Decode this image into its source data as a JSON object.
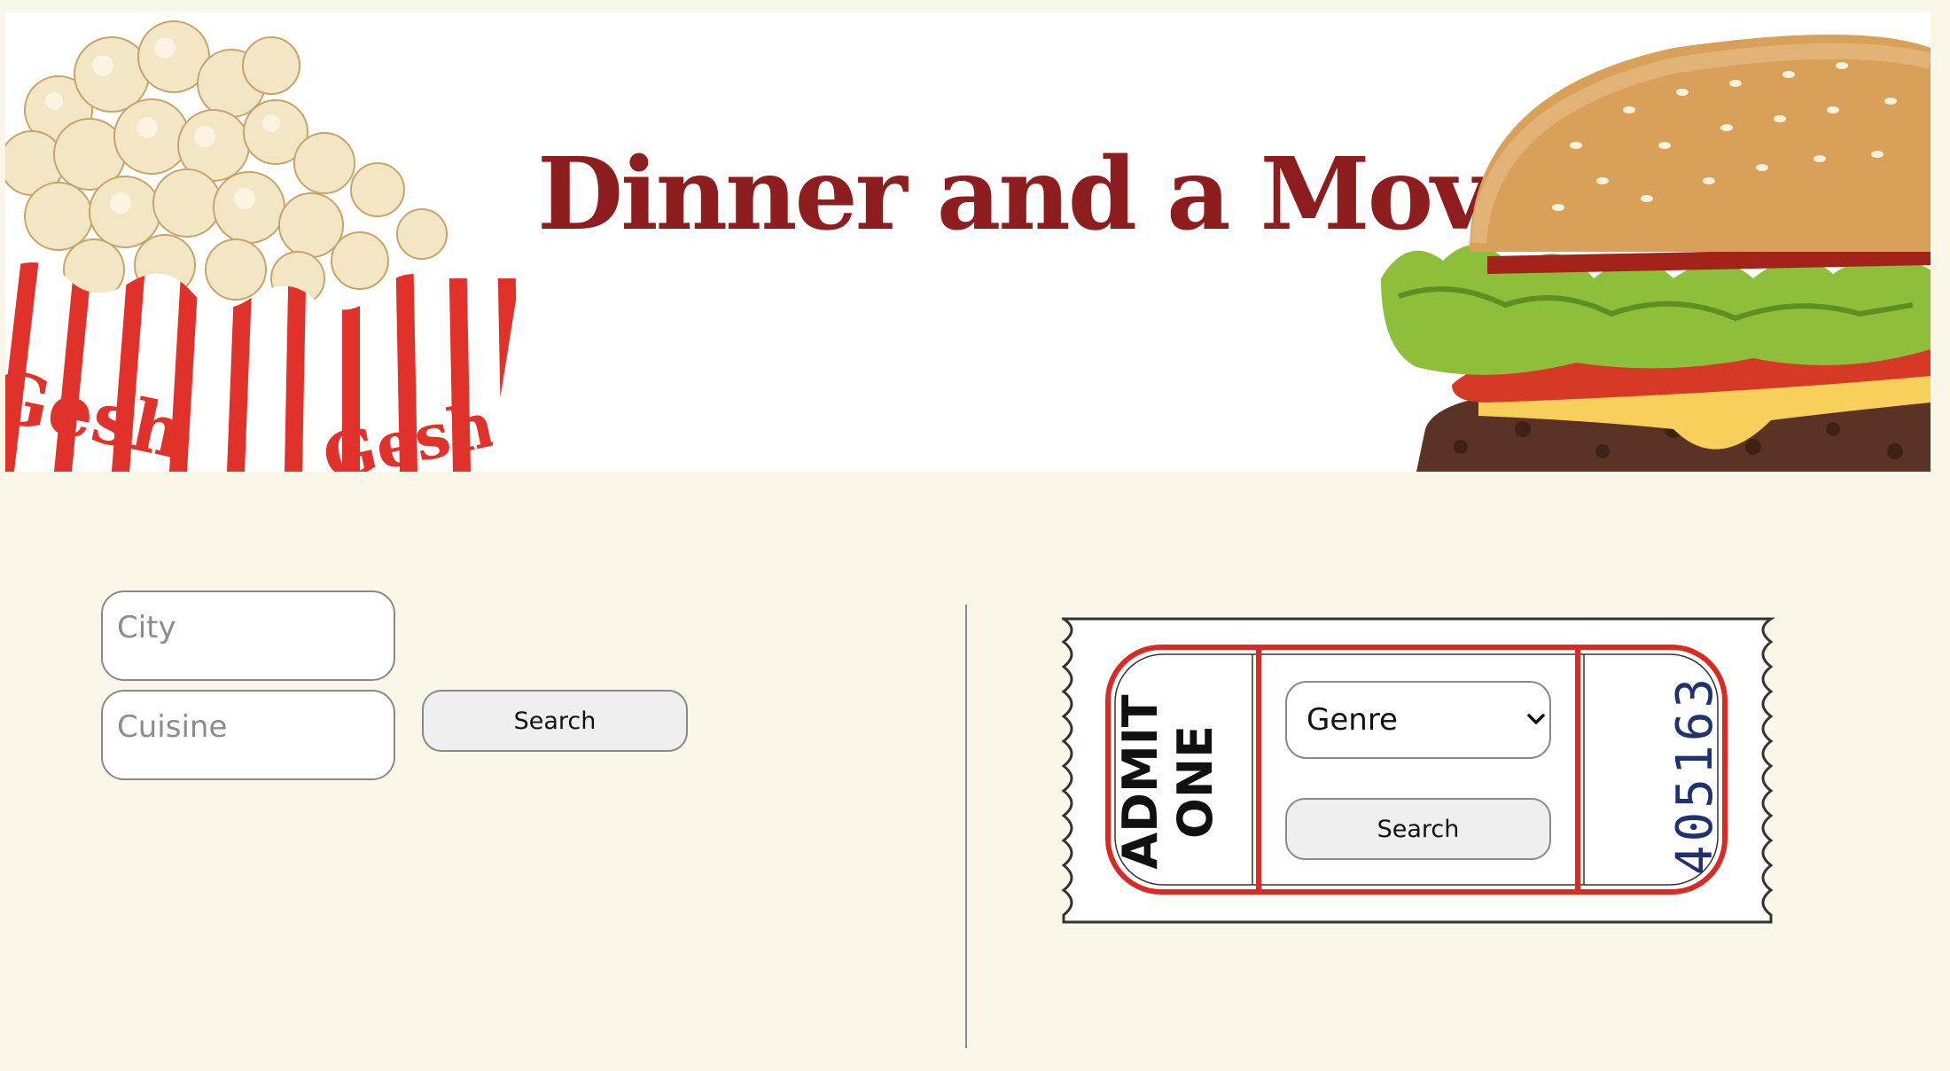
{
  "banner": {
    "title": "Dinner and a Movie",
    "popcorn_box_text": "Gesh",
    "title_color": "#8e1d1f",
    "stripe_color": "#e0312b"
  },
  "restaurant_search": {
    "city_placeholder": "City",
    "cuisine_placeholder": "Cuisine",
    "search_label": "Search"
  },
  "movie_search": {
    "admit_line1": "ADMIT",
    "admit_line2": "ONE",
    "genre_selected": "Genre",
    "search_label": "Search",
    "serial_number": "405163",
    "ticket_border_color": "#d92b23"
  }
}
